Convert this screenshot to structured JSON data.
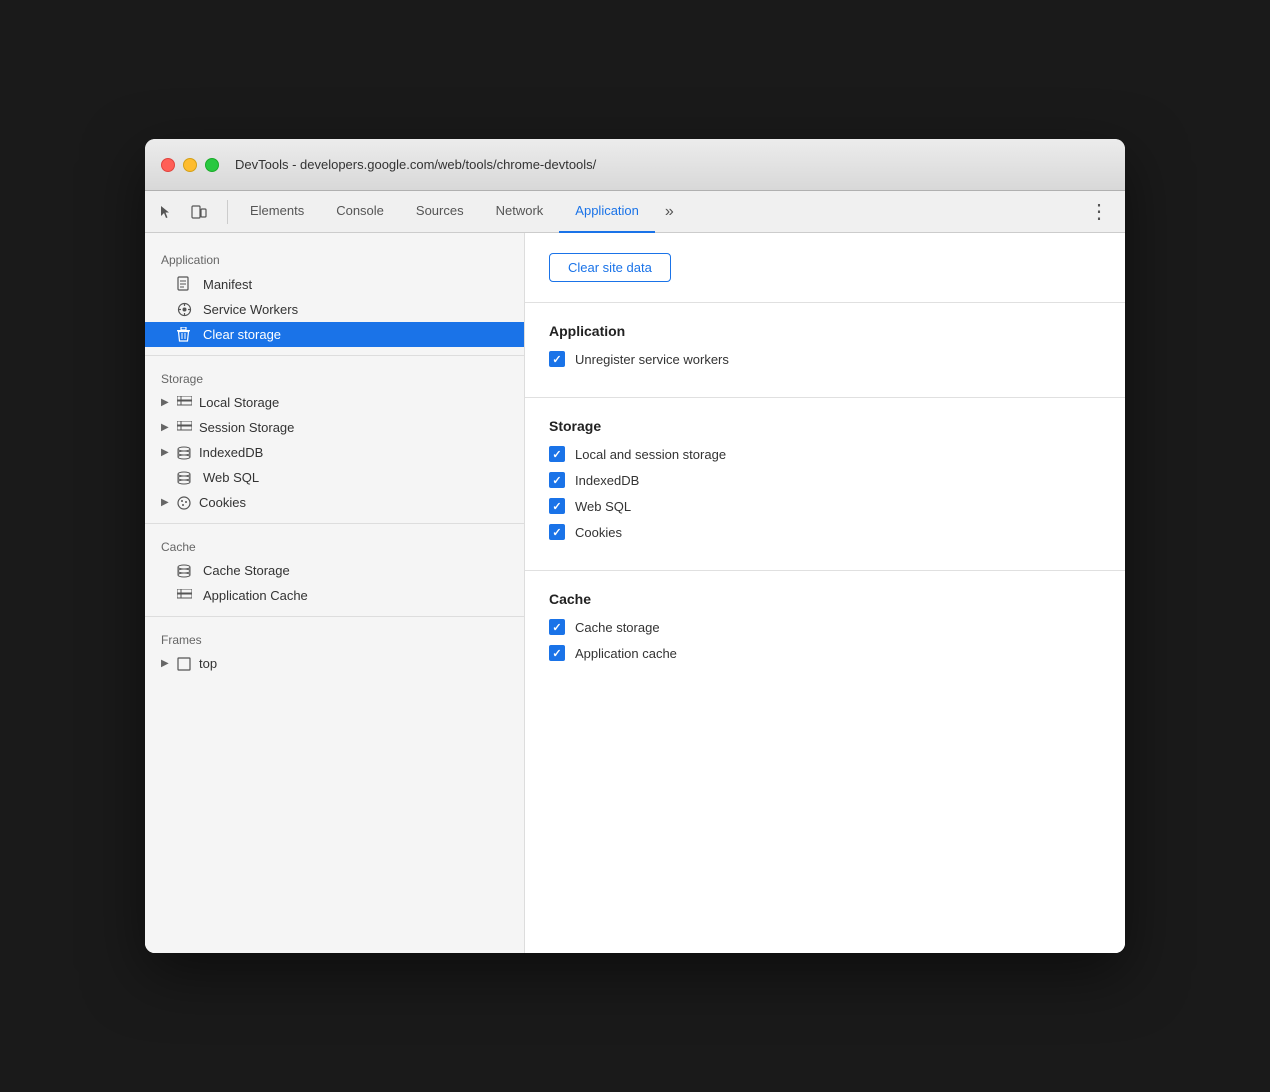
{
  "window": {
    "title": "DevTools - developers.google.com/web/tools/chrome-devtools/"
  },
  "toolbar": {
    "tabs": [
      {
        "id": "elements",
        "label": "Elements",
        "active": false
      },
      {
        "id": "console",
        "label": "Console",
        "active": false
      },
      {
        "id": "sources",
        "label": "Sources",
        "active": false
      },
      {
        "id": "network",
        "label": "Network",
        "active": false
      },
      {
        "id": "application",
        "label": "Application",
        "active": true
      }
    ],
    "overflow_label": "»",
    "more_label": "⋮"
  },
  "sidebar": {
    "sections": [
      {
        "id": "application",
        "label": "Application",
        "items": [
          {
            "id": "manifest",
            "label": "Manifest",
            "icon": "manifest",
            "expandable": false,
            "active": false
          },
          {
            "id": "service-workers",
            "label": "Service Workers",
            "icon": "service-worker",
            "expandable": false,
            "active": false
          },
          {
            "id": "clear-storage",
            "label": "Clear storage",
            "icon": "trash",
            "expandable": false,
            "active": true
          }
        ]
      },
      {
        "id": "storage",
        "label": "Storage",
        "items": [
          {
            "id": "local-storage",
            "label": "Local Storage",
            "icon": "grid",
            "expandable": true,
            "active": false
          },
          {
            "id": "session-storage",
            "label": "Session Storage",
            "icon": "grid",
            "expandable": true,
            "active": false
          },
          {
            "id": "indexeddb",
            "label": "IndexedDB",
            "icon": "db",
            "expandable": true,
            "active": false
          },
          {
            "id": "web-sql",
            "label": "Web SQL",
            "icon": "db",
            "expandable": false,
            "active": false
          },
          {
            "id": "cookies",
            "label": "Cookies",
            "icon": "cookies",
            "expandable": true,
            "active": false
          }
        ]
      },
      {
        "id": "cache",
        "label": "Cache",
        "items": [
          {
            "id": "cache-storage",
            "label": "Cache Storage",
            "icon": "cache",
            "expandable": false,
            "active": false
          },
          {
            "id": "application-cache",
            "label": "Application Cache",
            "icon": "grid",
            "expandable": false,
            "active": false
          }
        ]
      },
      {
        "id": "frames",
        "label": "Frames",
        "items": [
          {
            "id": "top",
            "label": "top",
            "icon": "frame",
            "expandable": true,
            "active": false
          }
        ]
      }
    ]
  },
  "right_panel": {
    "clear_button_label": "Clear site data",
    "sections": [
      {
        "id": "application",
        "title": "Application",
        "checkboxes": [
          {
            "id": "unregister-sw",
            "label": "Unregister service workers",
            "checked": true
          }
        ]
      },
      {
        "id": "storage",
        "title": "Storage",
        "checkboxes": [
          {
            "id": "local-session-storage",
            "label": "Local and session storage",
            "checked": true
          },
          {
            "id": "indexeddb",
            "label": "IndexedDB",
            "checked": true
          },
          {
            "id": "web-sql",
            "label": "Web SQL",
            "checked": true
          },
          {
            "id": "cookies",
            "label": "Cookies",
            "checked": true
          }
        ]
      },
      {
        "id": "cache",
        "title": "Cache",
        "checkboxes": [
          {
            "id": "cache-storage",
            "label": "Cache storage",
            "checked": true
          },
          {
            "id": "application-cache",
            "label": "Application cache",
            "checked": true
          }
        ]
      }
    ]
  },
  "colors": {
    "accent": "#1a73e8",
    "active_bg": "#1a73e8",
    "sidebar_bg": "#f5f5f5"
  }
}
